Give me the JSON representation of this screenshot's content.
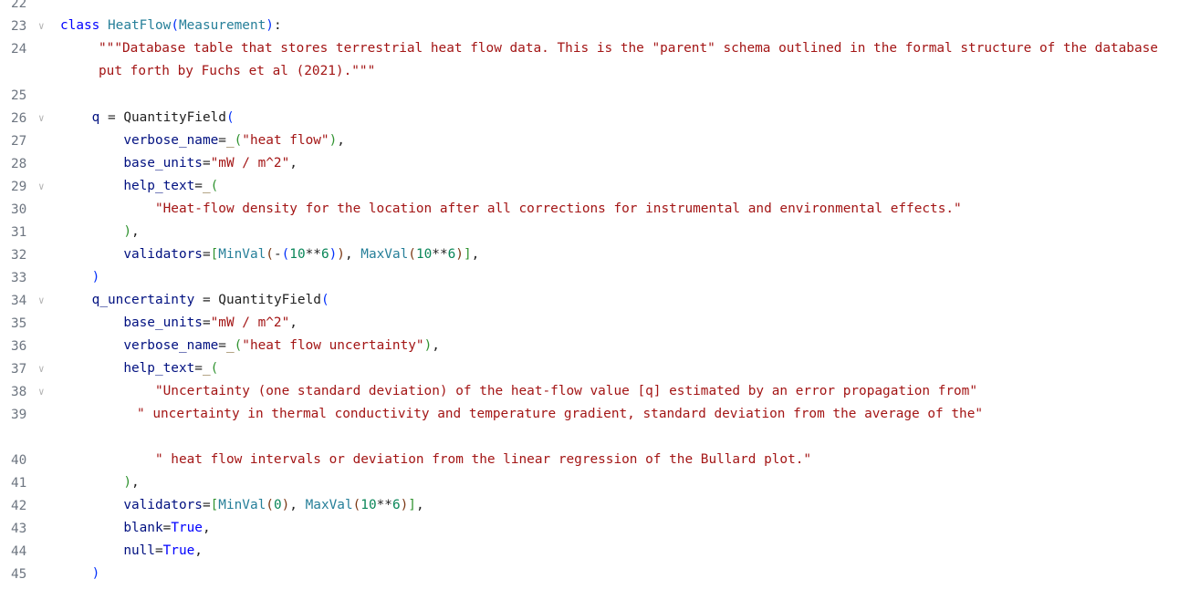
{
  "editor": {
    "lines": [
      {
        "n": "22",
        "fold": false
      },
      {
        "n": "23",
        "fold": true
      },
      {
        "n": "24",
        "fold": false
      },
      {
        "n": "25",
        "fold": false
      },
      {
        "n": "26",
        "fold": true
      },
      {
        "n": "27",
        "fold": false
      },
      {
        "n": "28",
        "fold": false
      },
      {
        "n": "29",
        "fold": true
      },
      {
        "n": "30",
        "fold": false
      },
      {
        "n": "31",
        "fold": false
      },
      {
        "n": "32",
        "fold": false
      },
      {
        "n": "33",
        "fold": false
      },
      {
        "n": "34",
        "fold": true
      },
      {
        "n": "35",
        "fold": false
      },
      {
        "n": "36",
        "fold": false
      },
      {
        "n": "37",
        "fold": true
      },
      {
        "n": "38",
        "fold": true
      },
      {
        "n": "39",
        "fold": false
      },
      {
        "n": "40",
        "fold": false
      },
      {
        "n": "41",
        "fold": false
      },
      {
        "n": "42",
        "fold": false
      },
      {
        "n": "43",
        "fold": false
      },
      {
        "n": "44",
        "fold": false
      },
      {
        "n": "45",
        "fold": false
      }
    ],
    "fold_glyph": "∨",
    "tokens": {
      "class_kw": "class",
      "class_name": "HeatFlow",
      "base_class": "Measurement",
      "docstring": "\"\"\"Database table that stores terrestrial heat flow data. This is the \"parent\" schema outlined in the formal structure of the database put forth by Fuchs et al (2021).\"\"\"",
      "q": "q",
      "quantity_field": "QuantityField",
      "verbose_name": "verbose_name",
      "underscore_fn": "_",
      "heat_flow_str": "\"heat flow\"",
      "base_units": "base_units",
      "units_str": "\"mW / m^2\"",
      "help_text": "help_text",
      "help_q_str": "\"Heat-flow density for the location after all corrections for instrumental and environmental effects.\"",
      "validators": "validators",
      "min_val": "MinVal",
      "max_val": "MaxVal",
      "num_10": "10",
      "num_6": "6",
      "num_0": "0",
      "q_uncertainty": "q_uncertainty",
      "heat_flow_unc_str": "\"heat flow uncertainty\"",
      "unc_str_1": "\"Uncertainty (one standard deviation) of the heat-flow value [q] estimated by an error propagation from\"",
      "unc_str_2": "\" uncertainty in thermal conductivity and temperature gradient, standard deviation from the average of the\"",
      "unc_str_3": "\" heat flow intervals or deviation from the linear regression of the Bullard plot.\"",
      "blank": "blank",
      "null": "null",
      "true_kw": "True"
    }
  },
  "colors": {
    "keyword": "#0000ff",
    "class_name": "#267f99",
    "string": "#a31515",
    "number": "#098658",
    "parameter": "#001080",
    "function": "#795e26",
    "line_number": "#6e7681"
  }
}
